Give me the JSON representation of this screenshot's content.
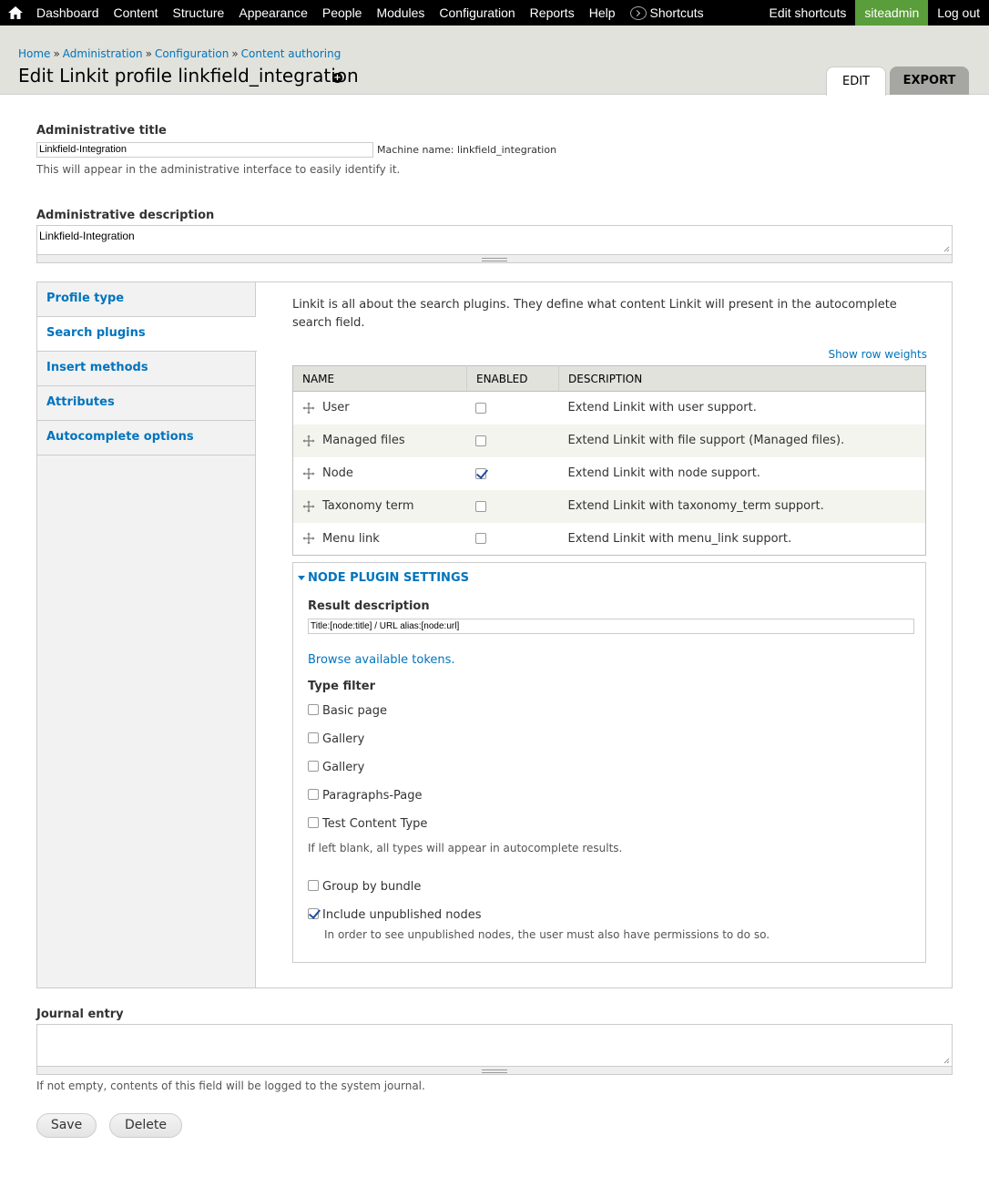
{
  "toolbar": {
    "menu": [
      "Dashboard",
      "Content",
      "Structure",
      "Appearance",
      "People",
      "Modules",
      "Configuration",
      "Reports",
      "Help"
    ],
    "shortcuts_label": "Shortcuts",
    "edit_shortcuts": "Edit shortcuts",
    "user": "siteadmin",
    "logout": "Log out"
  },
  "breadcrumb": [
    "Home",
    "Administration",
    "Configuration",
    "Content authoring"
  ],
  "page_title": "Edit Linkit profile linkfield_integration",
  "tabs": {
    "edit": "Edit",
    "export": "Export"
  },
  "form": {
    "title_label": "Administrative title",
    "title_value": "Linkfield-Integration",
    "machine_name": "Machine name: linkfield_integration",
    "title_help": "This will appear in the administrative interface to easily identify it.",
    "description_label": "Administrative description",
    "description_value": "Linkfield-Integration"
  },
  "vertical_tabs": [
    "Profile type",
    "Search plugins",
    "Insert methods",
    "Attributes",
    "Autocomplete options"
  ],
  "search_plugins": {
    "intro": "Linkit is all about the search plugins. They define what content Linkit will present in the autocomplete search field.",
    "show_row_weights": "Show row weights",
    "columns": [
      "Name",
      "Enabled",
      "Description"
    ],
    "rows": [
      {
        "name": "User",
        "enabled": false,
        "description": "Extend Linkit with user support."
      },
      {
        "name": "Managed files",
        "enabled": false,
        "description": "Extend Linkit with file support (Managed files)."
      },
      {
        "name": "Node",
        "enabled": true,
        "description": "Extend Linkit with node support."
      },
      {
        "name": "Taxonomy term",
        "enabled": false,
        "description": "Extend Linkit with taxonomy_term support."
      },
      {
        "name": "Menu link",
        "enabled": false,
        "description": "Extend Linkit with menu_link support."
      }
    ]
  },
  "node_settings": {
    "legend": "Node plugin settings",
    "result_desc_label": "Result description",
    "result_desc_value": "Title:[node:title] / URL alias:[node:url]",
    "browse_tokens": "Browse available tokens.",
    "type_filter_label": "Type filter",
    "types": [
      {
        "label": "Basic page",
        "checked": false
      },
      {
        "label": "Gallery",
        "checked": false
      },
      {
        "label": "Gallery",
        "checked": false
      },
      {
        "label": "Paragraphs-Page",
        "checked": false
      },
      {
        "label": "Test Content Type",
        "checked": false
      }
    ],
    "type_help": "If left blank, all types will appear in autocomplete results.",
    "group_by_bundle": "Group by bundle",
    "include_unpublished": "Include unpublished nodes",
    "unpublished_help": "In order to see unpublished nodes, the user must also have permissions to do so."
  },
  "journal": {
    "label": "Journal entry",
    "help": "If not empty, contents of this field will be logged to the system journal."
  },
  "buttons": {
    "save": "Save",
    "delete": "Delete"
  }
}
